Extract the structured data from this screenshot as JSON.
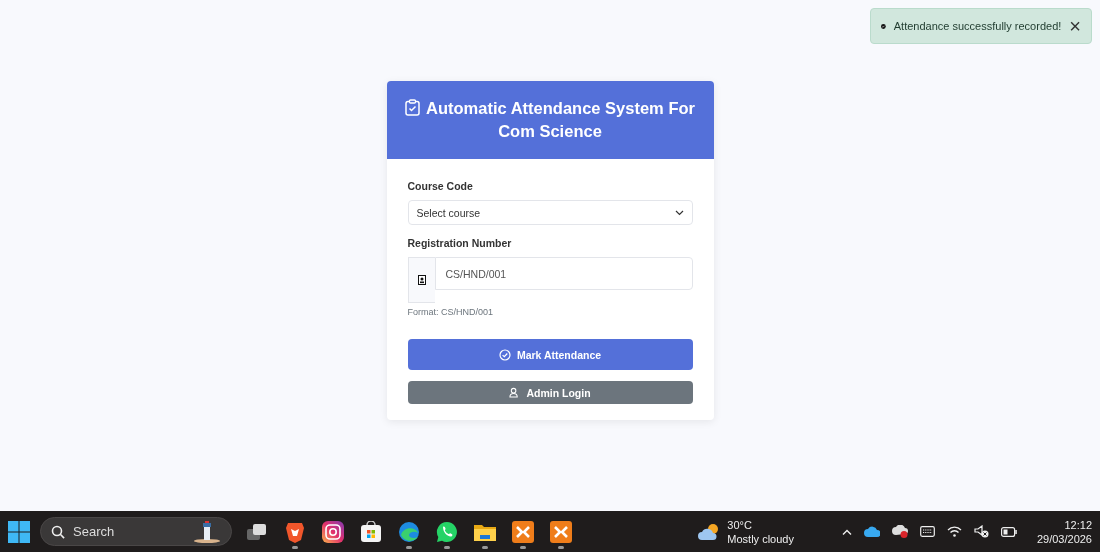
{
  "toast": {
    "message": "Attendance successfully recorded!",
    "close": "×"
  },
  "card": {
    "title": "Automatic Attendance System For Com Science",
    "course": {
      "label": "Course Code",
      "placeholder": "Select course"
    },
    "registration": {
      "label": "Registration Number",
      "placeholder": "CS/HND/001",
      "hint": "Format: CS/HND/001"
    },
    "buttons": [
      {
        "kind": "primary",
        "label": "Mark Attendance"
      },
      {
        "kind": "secondary",
        "label": "Admin Login"
      }
    ]
  },
  "taskbar": {
    "search": {
      "placeholder": "Search"
    },
    "apps": [
      {
        "kind": "taskview",
        "running": false
      },
      {
        "kind": "brave",
        "running": true
      },
      {
        "kind": "instagram",
        "running": false
      },
      {
        "kind": "store",
        "running": false
      },
      {
        "kind": "edge",
        "running": true
      },
      {
        "kind": "whatsapp",
        "running": true
      },
      {
        "kind": "explorer",
        "running": true
      },
      {
        "kind": "xampp",
        "running": true
      },
      {
        "kind": "xampp",
        "running": true
      }
    ],
    "weather": {
      "temp": "30°C",
      "condition": "Mostly cloudy"
    },
    "clock": {
      "time": "12:12",
      "date": "29/03/2026"
    }
  }
}
